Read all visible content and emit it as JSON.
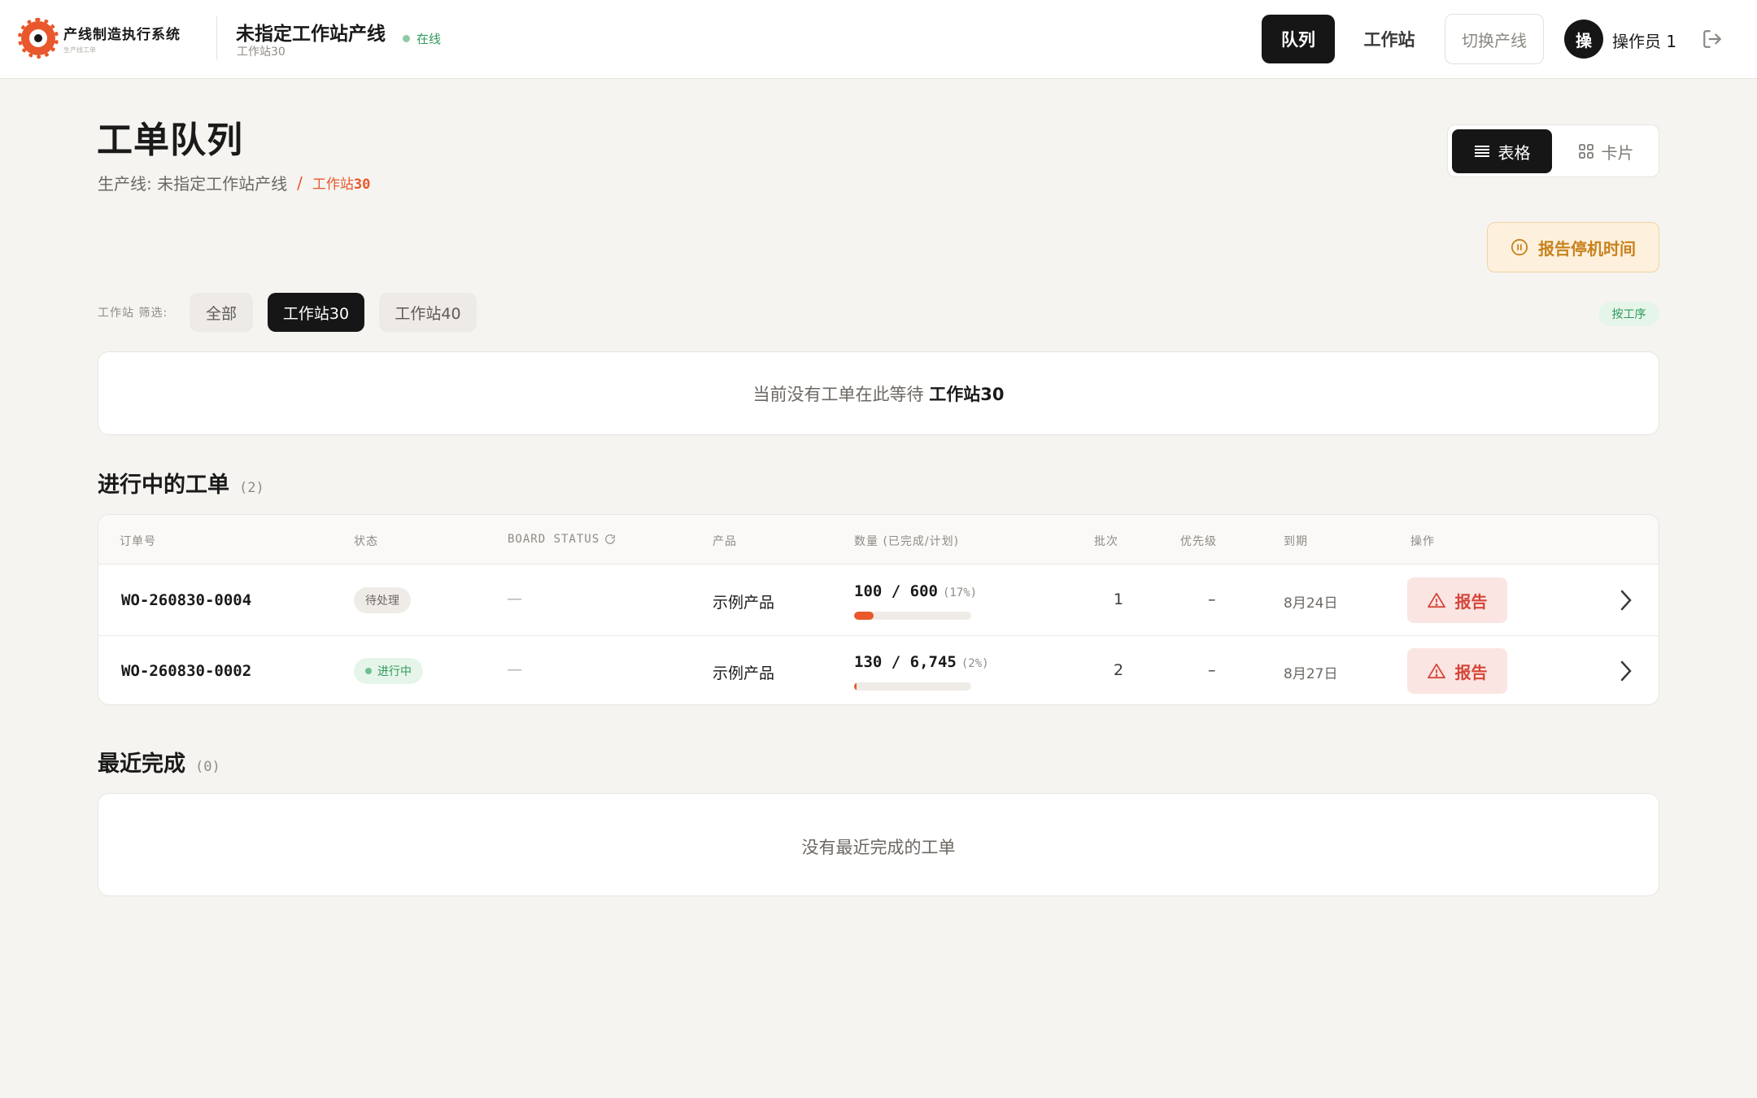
{
  "header": {
    "app_title": "产线制造执行系统",
    "app_subtitle": "生产线工单",
    "line_name": "未指定工作站产线",
    "station_name": "工作站30",
    "online_label": "在线",
    "nav": {
      "queue": "队列",
      "station": "工作站",
      "switch_line": "切换产线"
    },
    "avatar_initial": "操",
    "operator": "操作员 1"
  },
  "page": {
    "title": "工单队列",
    "breadcrumb_line": "生产线: 未指定工作站产线",
    "breadcrumb_sep": "/",
    "breadcrumb_station_prefix": "工作站",
    "breadcrumb_station_num": "30",
    "view_table": "表格",
    "view_card": "卡片",
    "report_downtime": "报告停机时间"
  },
  "filter": {
    "label": "工作站 筛选:",
    "chips": [
      "全部",
      "工作站30",
      "工作站40"
    ],
    "active": "工作站30",
    "sort_badge": "按工序"
  },
  "waiting": {
    "text": "当前没有工单在此等待",
    "station": "工作站30"
  },
  "in_progress": {
    "title": "进行中的工单",
    "count": "(2)",
    "columns": [
      "订单号",
      "状态",
      "BOARD STATUS",
      "产品",
      "数量 (已完成/计划)",
      "批次",
      "优先级",
      "到期",
      "操作"
    ],
    "rows": [
      {
        "order": "WO-260830-0004",
        "status": "待处理",
        "board_status": "—",
        "product": "示例产品",
        "qty": "100 / 600",
        "pct": "(17%)",
        "progress": 0.17,
        "batch": "1",
        "priority": "–",
        "due": "8月24日",
        "action": "报告"
      },
      {
        "order": "WO-260830-0002",
        "status": "进行中",
        "board_status": "—",
        "product": "示例产品",
        "qty": "130 / 6,745",
        "pct": "(2%)",
        "progress": 0.02,
        "batch": "2",
        "priority": "–",
        "due": "8月27日",
        "action": "报告"
      }
    ]
  },
  "recent": {
    "title": "最近完成",
    "count": "(0)",
    "empty": "没有最近完成的工单"
  },
  "colors": {
    "accent": "#e8582c",
    "dark": "#161616",
    "success": "#2f9a5a",
    "warning": "#c8821e",
    "danger": "#d6453a"
  }
}
